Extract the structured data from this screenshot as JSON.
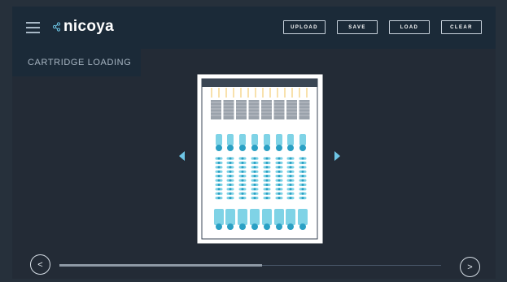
{
  "header": {
    "brand": "nicoya",
    "menu_icon": "hamburger-icon",
    "actions": [
      {
        "label": "UPLOAD"
      },
      {
        "label": "SAVE"
      },
      {
        "label": "LOAD"
      },
      {
        "label": "CLEAR"
      }
    ]
  },
  "section": {
    "title": "CARTRIDGE LOADING"
  },
  "cartridge": {
    "columns": 8,
    "filter_count": 8,
    "vial_rows": 10
  },
  "navigation": {
    "prev_label": "<",
    "next_label": ">",
    "progress": 0.53
  },
  "colors": {
    "background": "#232b36",
    "header": "#1b2a38",
    "accent": "#6ec6e6",
    "well_light": "#7fd3e6",
    "well_dark": "#2aa0c4",
    "pin": "#f0c35a"
  }
}
